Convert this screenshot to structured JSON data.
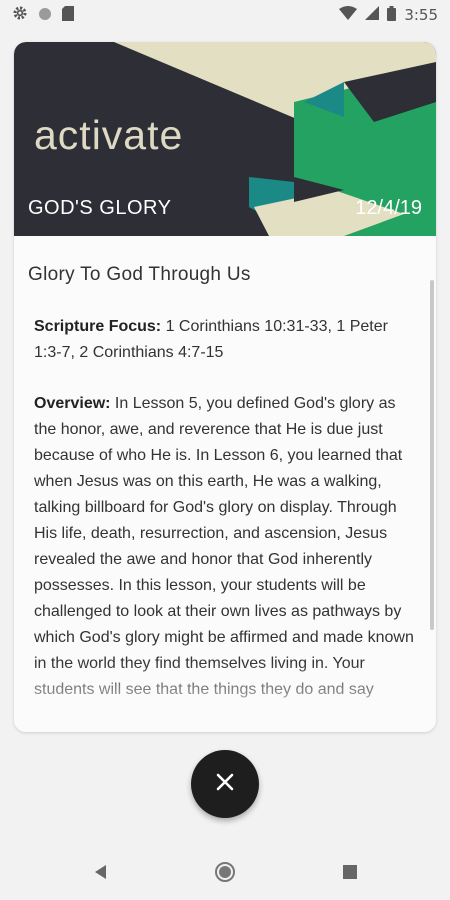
{
  "status_bar": {
    "time": "3:55",
    "icons": [
      "gear-icon",
      "circle-icon",
      "sd-card-icon",
      "wifi-icon",
      "signal-icon",
      "battery-icon"
    ]
  },
  "banner": {
    "word": "activate",
    "topic": "GOD'S GLORY",
    "date": "12/4/19",
    "colors": {
      "dark": "#2d2e36",
      "cream": "#e3dfc3",
      "green": "#24a262",
      "teal": "#1b8a86"
    }
  },
  "lesson": {
    "title": "Glory To God Through Us",
    "scripture_label": "Scripture Focus:",
    "scripture_text": " 1 Corinthians 10:31-33, 1 Peter 1:3-7, 2 Corinthians 4:7-15",
    "overview_label": "Overview:",
    "overview_text": " In Lesson 5, you defined God's glory as the honor, awe, and reverence that He is due just because of who He is. In Lesson 6, you learned that when Jesus was on this earth, He was a walking, talking billboard for God's glory on display. Through His life, death, resurrection, and ascension, Jesus revealed the awe and honor that God inherently possesses. In this lesson, your students will be challenged to look at their own lives as pathways by which God's glory might be affirmed and made known in the world they find themselves living in. Your students will see that the things they do and say"
  },
  "fab": {
    "icon": "close-icon"
  },
  "nav": {
    "icons": [
      "back-icon",
      "home-icon",
      "recents-icon"
    ]
  }
}
